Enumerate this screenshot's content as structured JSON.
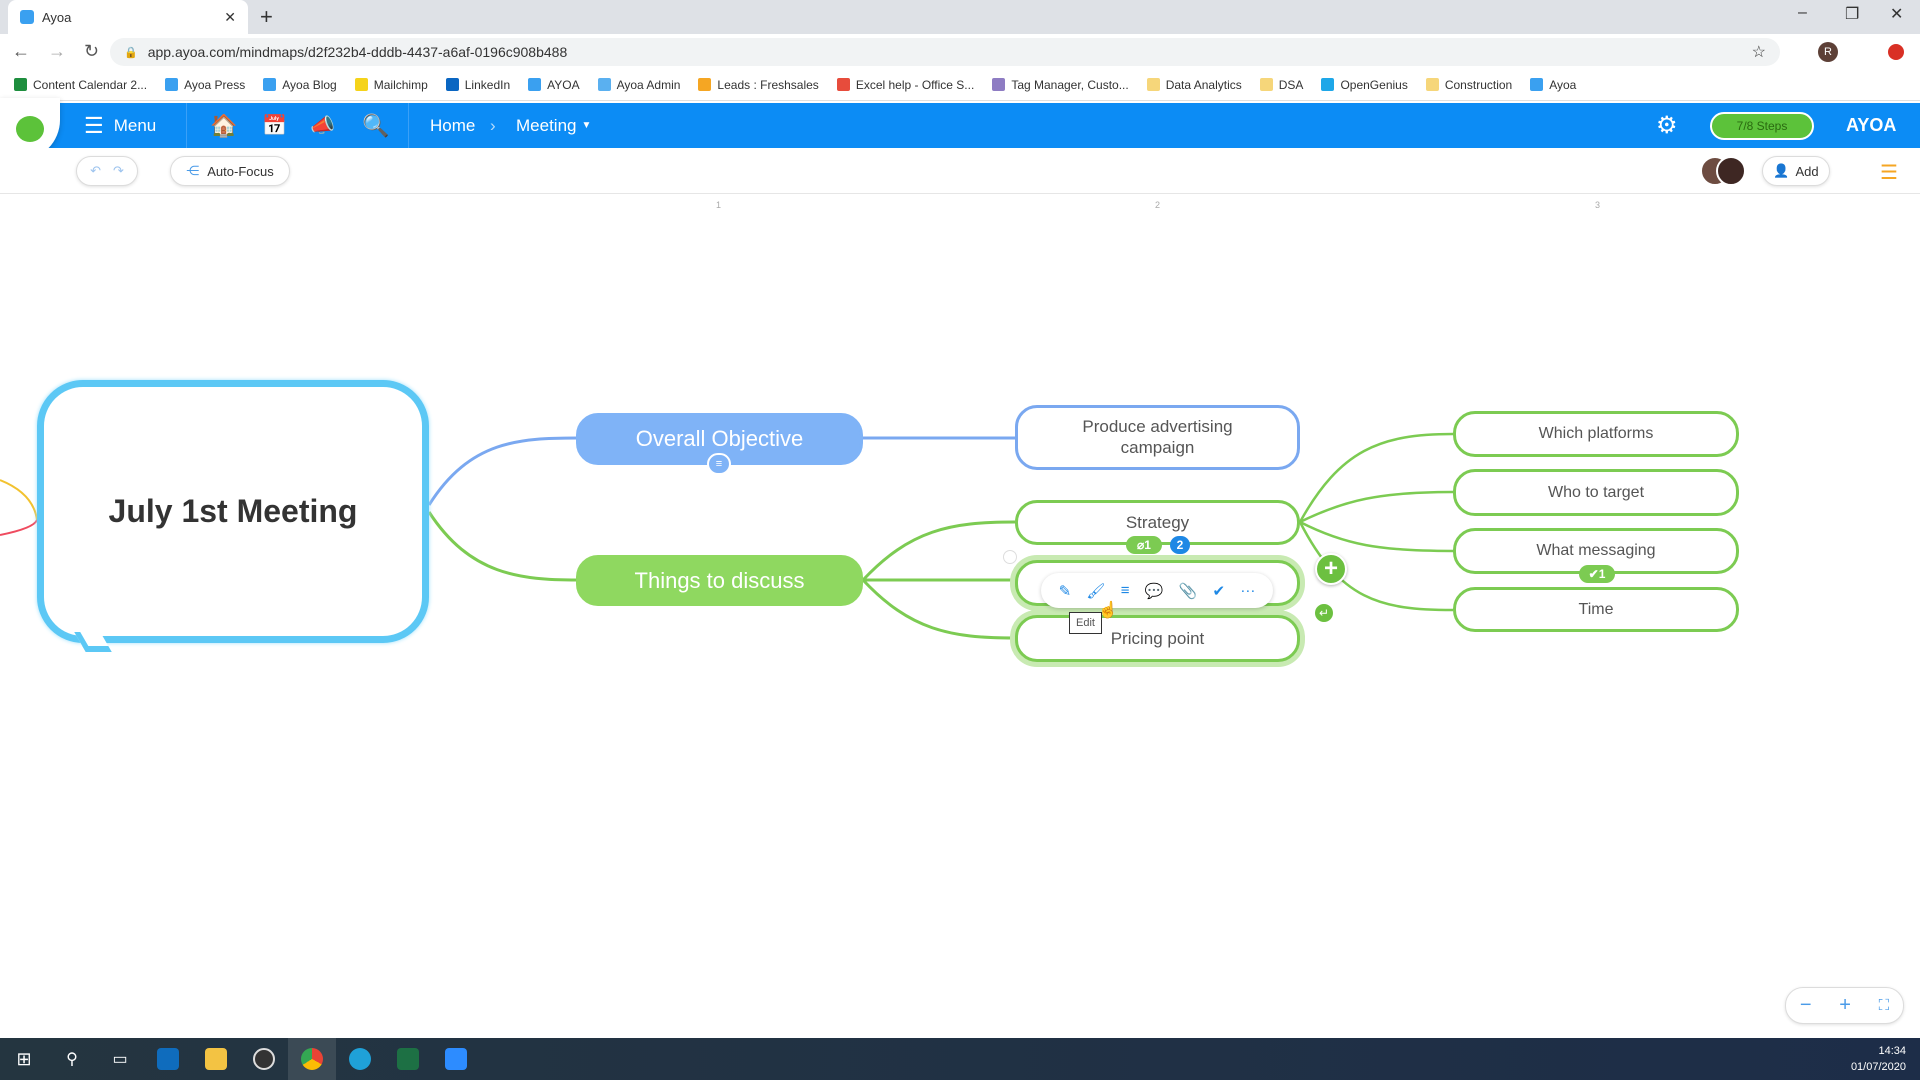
{
  "browser": {
    "tab_title": "Ayoa",
    "url": "app.ayoa.com/mindmaps/d2f232b4-dddb-4437-a6af-0196c908b488",
    "profile_initial": "R",
    "bookmarks": [
      {
        "label": "Content Calendar 2...",
        "color": "#1e8e3e"
      },
      {
        "label": "Ayoa Press",
        "color": "#3aa0f0"
      },
      {
        "label": "Ayoa Blog",
        "color": "#3aa0f0"
      },
      {
        "label": "Mailchimp",
        "color": "#f5d31a"
      },
      {
        "label": "LinkedIn",
        "color": "#0a66c2"
      },
      {
        "label": "AYOA",
        "color": "#3aa0f0"
      },
      {
        "label": "Ayoa Admin",
        "color": "#5ab0f0"
      },
      {
        "label": "Leads : Freshsales",
        "color": "#f5a623"
      },
      {
        "label": "Excel help - Office S...",
        "color": "#e74c3c"
      },
      {
        "label": "Tag Manager, Custo...",
        "color": "#8e7cc3"
      },
      {
        "label": "Data Analytics",
        "color": "#f6d67a"
      },
      {
        "label": "DSA",
        "color": "#f6d67a"
      },
      {
        "label": "OpenGenius",
        "color": "#1ea7e8"
      },
      {
        "label": "Construction",
        "color": "#f6d67a"
      },
      {
        "label": "Ayoa",
        "color": "#3aa0f0"
      }
    ]
  },
  "header": {
    "menu_label": "Menu",
    "breadcrumb": [
      "Home",
      "Meeting"
    ],
    "steps_label": "7/8 Steps",
    "brand": "AYOA",
    "steps_progress": 0.875
  },
  "toolbar": {
    "autofocus_label": "Auto-Focus",
    "add_label": "Add"
  },
  "ruler": [
    "1",
    "2",
    "3"
  ],
  "mindmap": {
    "central": "July 1st Meeting",
    "branches": {
      "objective": "Overall Objective",
      "discuss": "Things to discuss"
    },
    "nodes": {
      "campaign": "Produce advertising campaign",
      "strategy": "Strategy",
      "blank": "",
      "pricing": "Pricing point"
    },
    "leaves": [
      "Which platforms",
      "Who to target",
      "What messaging",
      "Time"
    ],
    "badges": {
      "strategy_attach": "1",
      "strategy_count": "2",
      "messaging_check": "1"
    },
    "tooltip": "Edit",
    "colors": {
      "central": "#5cc8f5",
      "objective": "#7fb3f7",
      "discuss": "#8fd860",
      "green_line": "#7ccb52",
      "blue_line": "#7aa8f0"
    }
  },
  "node_toolbar": [
    "pencil-icon",
    "paintbrush-icon",
    "notes-icon",
    "comment-icon",
    "attachment-icon",
    "check-icon",
    "more-icon"
  ],
  "taskbar": {
    "time": "14:34",
    "date": "01/07/2020"
  }
}
